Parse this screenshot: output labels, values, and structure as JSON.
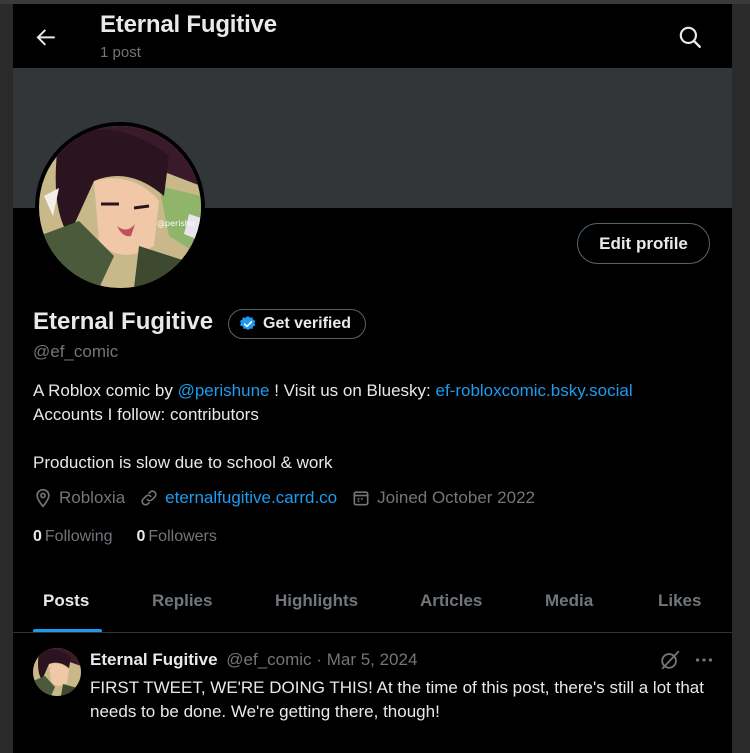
{
  "header": {
    "title": "Eternal Fugitive",
    "subtitle": "1 post",
    "back_icon": "arrow-left-icon",
    "search_icon": "search-icon"
  },
  "profile": {
    "name": "Eternal Fugitive",
    "get_verified": "Get verified",
    "handle": "@ef_comic",
    "edit_profile": "Edit profile",
    "bio": {
      "line1_pre": "A Roblox comic by ",
      "mention": "@perishune",
      "line1_mid": " ! Visit us on Bluesky: ",
      "bluesky_link": "ef-robloxcomic.bsky.social",
      "line2": "Accounts I follow: contributors",
      "line3": "Production is slow due to school & work"
    },
    "location": "Robloxia",
    "website": "eternalfugitive.carrd.co",
    "joined": "Joined October 2022",
    "following_count": "0",
    "following_label": "Following",
    "followers_count": "0",
    "followers_label": "Followers",
    "avatar_watermark": "@perishu"
  },
  "tabs": [
    "Posts",
    "Replies",
    "Highlights",
    "Articles",
    "Media",
    "Likes"
  ],
  "post": {
    "author": "Eternal Fugitive",
    "handle": "@ef_comic",
    "separator": "·",
    "date": "Mar 5, 2024",
    "text": "FIRST TWEET, WE'RE DOING THIS! At the time of this post, there's still a lot that needs to be done. We're getting there, though!"
  },
  "colors": {
    "accent": "#1d9bf0",
    "background": "#000000",
    "banner": "#333639",
    "muted": "#71767b"
  }
}
